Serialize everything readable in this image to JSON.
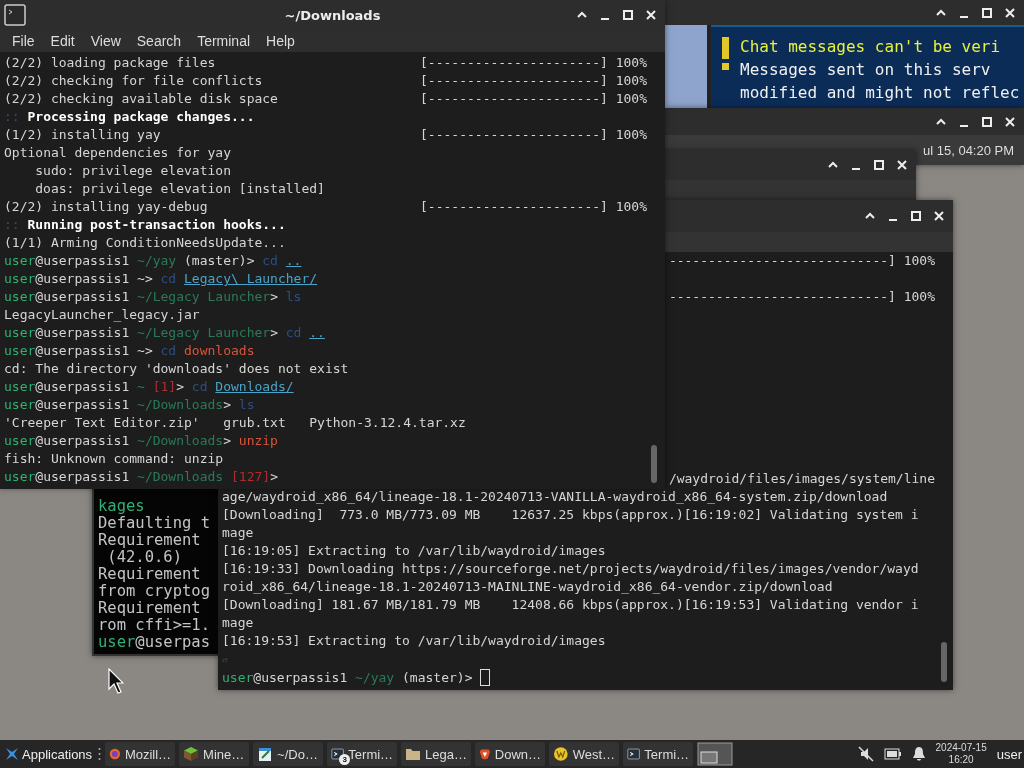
{
  "windows": [
    {
      "kind": "game",
      "chat_warning": {
        "title": "Chat messages can't be veri",
        "lines": [
          "Messages sent on this serv",
          "modified and might not reflec"
        ]
      }
    },
    {
      "kind": "panel",
      "clock_text": "ul 15, 04:20 PM"
    },
    {
      "kind": "blank"
    },
    {
      "kind": "side-terminal",
      "lines": [
        {
          "segments": [
            {
              "text": "kages",
              "kind": "user"
            }
          ]
        },
        {
          "segments": [
            {
              "text": "Defaulting t",
              "kind": "plain"
            }
          ]
        },
        {
          "segments": [
            {
              "text": "Requirement",
              "kind": "plain"
            }
          ]
        },
        {
          "segments": [
            {
              "text": " (42.0.6)",
              "kind": "plain"
            }
          ]
        },
        {
          "segments": [
            {
              "text": "Requirement",
              "kind": "plain"
            }
          ]
        },
        {
          "segments": [
            {
              "text": "from cryptog",
              "kind": "plain"
            }
          ]
        },
        {
          "segments": [
            {
              "text": "Requirement",
              "kind": "plain"
            }
          ]
        },
        {
          "segments": [
            {
              "text": "rom cffi>=1.",
              "kind": "plain"
            }
          ]
        },
        {
          "segments": [
            {
              "text": "user",
              "kind": "user"
            },
            {
              "text": "@userpas",
              "kind": "plain"
            }
          ]
        }
      ]
    },
    {
      "kind": "back-terminal",
      "top_lines": [
        {
          "progress": "----------------------------] 100%"
        },
        {
          "progress": "----------------------------] 100%"
        }
      ],
      "bottom_lines": [
        {
          "kind": "clipped",
          "segments": [
            {
              "text": "/waydroid/files/images/system/line",
              "kind": "plain"
            }
          ]
        },
        {
          "kind": "full",
          "segments": [
            {
              "text": "age/waydroid_x86_64/lineage-18.1-20240713-VANILLA-waydroid_x86_64-system.zip/download",
              "kind": "plain"
            }
          ]
        },
        {
          "kind": "full",
          "segments": [
            {
              "text": "[Downloading]  773.0 MB/773.09 MB    12637.25 kbps(approx.)[16:19:02] Validating system i",
              "kind": "plain"
            }
          ]
        },
        {
          "kind": "full",
          "segments": [
            {
              "text": "mage",
              "kind": "plain"
            }
          ]
        },
        {
          "kind": "full",
          "segments": [
            {
              "text": "[16:19:05] Extracting to /var/lib/waydroid/images",
              "kind": "plain"
            }
          ]
        },
        {
          "kind": "full",
          "segments": [
            {
              "text": "[16:19:33] Downloading https://sourceforge.net/projects/waydroid/files/images/vendor/wayd",
              "kind": "plain"
            }
          ]
        },
        {
          "kind": "full",
          "segments": [
            {
              "text": "roid_x86_64/lineage-18.1-20240713-MAINLINE-waydroid_x86_64-vendor.zip/download",
              "kind": "plain"
            }
          ]
        },
        {
          "kind": "full",
          "segments": [
            {
              "text": "[Downloading] 181.67 MB/181.79 MB    12408.66 kbps(approx.)[16:19:53] Validating vendor i",
              "kind": "plain"
            }
          ]
        },
        {
          "kind": "full",
          "segments": [
            {
              "text": "mage",
              "kind": "plain"
            }
          ]
        },
        {
          "kind": "full",
          "segments": [
            {
              "text": "[16:19:53] Extracting to /var/lib/waydroid/images",
              "kind": "plain"
            }
          ]
        },
        {
          "kind": "full",
          "segments": [
            {
              "text": "⏎",
              "kind": "dim"
            }
          ]
        },
        {
          "kind": "full",
          "cursor": true,
          "segments": [
            {
              "text": "user",
              "kind": "user"
            },
            {
              "text": "@userpassis1 ",
              "kind": "plain"
            },
            {
              "text": "~/yay",
              "kind": "path"
            },
            {
              "text": " (master)> ",
              "kind": "plain"
            }
          ]
        }
      ]
    },
    {
      "kind": "main-terminal",
      "title": "~/Downloads",
      "menu": [
        "File",
        "Edit",
        "View",
        "Search",
        "Terminal",
        "Help"
      ],
      "lines": [
        {
          "segments": [
            {
              "text": "(2/2) loading package files",
              "kind": "plain"
            }
          ],
          "progress": "[----------------------] 100%"
        },
        {
          "segments": [
            {
              "text": "(2/2) checking for file conflicts",
              "kind": "plain"
            }
          ],
          "progress": "[----------------------] 100%"
        },
        {
          "segments": [
            {
              "text": "(2/2) checking available disk space",
              "kind": "plain"
            }
          ],
          "progress": "[----------------------] 100%"
        },
        {
          "segments": [
            {
              "text": "::",
              "kind": "marker"
            },
            {
              "text": " Processing package changes...",
              "kind": "bold"
            }
          ]
        },
        {
          "segments": [
            {
              "text": "(1/2) installing yay",
              "kind": "plain"
            }
          ],
          "progress": "[----------------------] 100%"
        },
        {
          "segments": [
            {
              "text": "Optional dependencies for yay",
              "kind": "plain"
            }
          ]
        },
        {
          "indented": true,
          "segments": [
            {
              "text": "sudo: privilege elevation",
              "kind": "plain"
            }
          ]
        },
        {
          "indented": true,
          "segments": [
            {
              "text": "doas: privilege elevation [installed]",
              "kind": "plain"
            }
          ]
        },
        {
          "segments": [
            {
              "text": "(2/2) installing yay-debug",
              "kind": "plain"
            }
          ],
          "progress": "[----------------------] 100%"
        },
        {
          "segments": [
            {
              "text": "::",
              "kind": "marker"
            },
            {
              "text": " Running post-transaction hooks...",
              "kind": "bold"
            }
          ]
        },
        {
          "segments": [
            {
              "text": "(1/1) Arming ConditionNeedsUpdate...",
              "kind": "plain"
            }
          ]
        },
        {
          "segments": [
            {
              "text": "user",
              "kind": "user"
            },
            {
              "text": "@userpassis1 ",
              "kind": "plain"
            },
            {
              "text": "~/yay",
              "kind": "path"
            },
            {
              "text": " (master)> ",
              "kind": "plain"
            },
            {
              "text": "cd ",
              "kind": "command"
            },
            {
              "text": "..",
              "kind": "link"
            }
          ]
        },
        {
          "segments": [
            {
              "text": "user",
              "kind": "user"
            },
            {
              "text": "@userpassis1 ~> ",
              "kind": "plain"
            },
            {
              "text": "cd ",
              "kind": "command"
            },
            {
              "text": "Legacy\\ Launcher/",
              "kind": "link"
            }
          ]
        },
        {
          "segments": [
            {
              "text": "user",
              "kind": "user"
            },
            {
              "text": "@userpassis1 ",
              "kind": "plain"
            },
            {
              "text": "~/Legacy Launcher",
              "kind": "path"
            },
            {
              "text": "> ",
              "kind": "plain"
            },
            {
              "text": "ls",
              "kind": "command"
            }
          ]
        },
        {
          "segments": [
            {
              "text": "LegacyLauncher_legacy.jar",
              "kind": "plain"
            }
          ]
        },
        {
          "segments": [
            {
              "text": "user",
              "kind": "user"
            },
            {
              "text": "@userpassis1 ",
              "kind": "plain"
            },
            {
              "text": "~/Legacy Launcher",
              "kind": "path"
            },
            {
              "text": "> ",
              "kind": "plain"
            },
            {
              "text": "cd ",
              "kind": "command"
            },
            {
              "text": "..",
              "kind": "link"
            }
          ]
        },
        {
          "segments": [
            {
              "text": "user",
              "kind": "user"
            },
            {
              "text": "@userpassis1 ~> ",
              "kind": "plain"
            },
            {
              "text": "cd ",
              "kind": "command"
            },
            {
              "text": "downloads",
              "kind": "error"
            }
          ]
        },
        {
          "segments": [
            {
              "text": "cd: The directory 'downloads' does not exist",
              "kind": "plain"
            }
          ]
        },
        {
          "segments": [
            {
              "text": "user",
              "kind": "user"
            },
            {
              "text": "@userpassis1 ",
              "kind": "plain"
            },
            {
              "text": "~",
              "kind": "path"
            },
            {
              "text": " [1]",
              "kind": "status"
            },
            {
              "text": "> ",
              "kind": "plain"
            },
            {
              "text": "cd ",
              "kind": "command"
            },
            {
              "text": "Downloads/",
              "kind": "link"
            }
          ]
        },
        {
          "segments": [
            {
              "text": "user",
              "kind": "user"
            },
            {
              "text": "@userpassis1 ",
              "kind": "plain"
            },
            {
              "text": "~/Downloads",
              "kind": "path"
            },
            {
              "text": "> ",
              "kind": "plain"
            },
            {
              "text": "ls",
              "kind": "command"
            }
          ]
        },
        {
          "segments": [
            {
              "text": "'Creeper Text Editor.zip'   grub.txt   Python-3.12.4.tar.xz",
              "kind": "plain"
            }
          ]
        },
        {
          "segments": [
            {
              "text": "user",
              "kind": "user"
            },
            {
              "text": "@userpassis1 ",
              "kind": "plain"
            },
            {
              "text": "~/Downloads",
              "kind": "path"
            },
            {
              "text": "> ",
              "kind": "plain"
            },
            {
              "text": "unzip",
              "kind": "error"
            }
          ]
        },
        {
          "segments": [
            {
              "text": "fish: Unknown command: unzip",
              "kind": "plain"
            }
          ]
        },
        {
          "segments": [
            {
              "text": "user",
              "kind": "user"
            },
            {
              "text": "@userpassis1 ",
              "kind": "plain"
            },
            {
              "text": "~/Downloads",
              "kind": "path"
            },
            {
              "text": " [127]",
              "kind": "status"
            },
            {
              "text": ">",
              "kind": "plain"
            }
          ]
        }
      ]
    }
  ],
  "taskbar": {
    "menu_button": "Applications",
    "tasks": [
      {
        "kind": "browser",
        "label": "Mozill…"
      },
      {
        "kind": "cube",
        "label": "Mine…"
      },
      {
        "kind": "editor",
        "label": "~/Do…"
      },
      {
        "kind": "terminal",
        "label": "Termi…",
        "badge": "3"
      },
      {
        "kind": "folder",
        "label": "Lega…"
      },
      {
        "kind": "shield",
        "label": "Down…"
      },
      {
        "kind": "coin",
        "label": "West…"
      },
      {
        "kind": "terminal",
        "label": "Termi…"
      }
    ],
    "date": "2024-07-15",
    "time": "16:20",
    "user": "user"
  }
}
